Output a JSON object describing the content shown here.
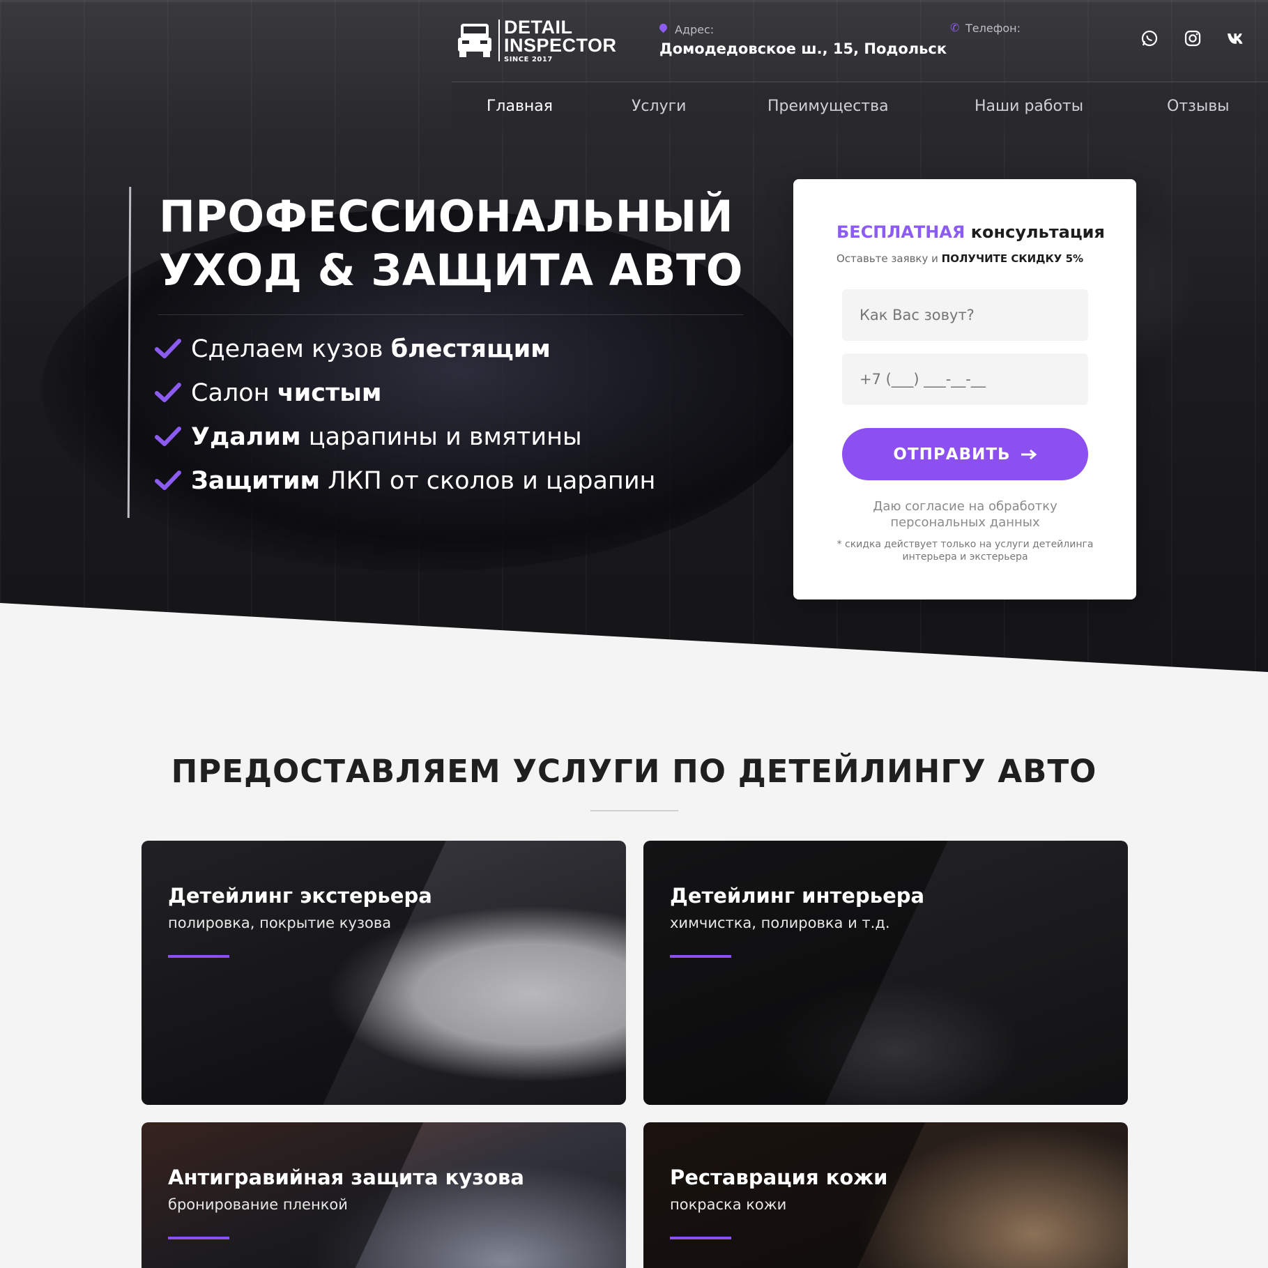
{
  "brand": {
    "line1": "DETAIL",
    "line2": "INSPECTOR",
    "since": "SINCE 2017"
  },
  "header": {
    "address_label": "Адрес:",
    "address_value": "Домодедовское ш., 15, Подольск",
    "phone_label": "Телефон:",
    "socials": [
      "whatsapp-icon",
      "instagram-icon",
      "vk-icon"
    ]
  },
  "nav": {
    "items": [
      "Главная",
      "Услуги",
      "Преимущества",
      "Наши работы",
      "Отзывы"
    ],
    "active": "Главная"
  },
  "hero": {
    "title_line1": "ПРОФЕССИОНАЛЬНЫЙ",
    "title_line2": "УХОД & ЗАЩИТА АВТО",
    "bullets": [
      {
        "plain_before": "Сделаем кузов ",
        "bold": "блестящим",
        "plain_after": ""
      },
      {
        "plain_before": "Салон ",
        "bold": "чистым",
        "plain_after": ""
      },
      {
        "plain_before": "",
        "bold": "Удалим",
        "plain_after": " царапины и вмятины"
      },
      {
        "plain_before": "",
        "bold": "Защитим",
        "plain_after": " ЛКП от сколов и царапин"
      }
    ]
  },
  "form": {
    "title_accent": "БЕСПЛАТНАЯ",
    "title_rest": " консультация",
    "sub_plain": "Оставьте заявку и ",
    "sub_bold": "ПОЛУЧИТЕ СКИДКУ 5%",
    "name_placeholder": "Как Вас зовут?",
    "phone_placeholder": "+7 (___) ___-__-__",
    "submit_label": "ОТПРАВИТЬ",
    "consent": "Даю согласие на обработку персональных данных",
    "disclaimer": "* скидка действует только на услуги детейлинга интерьера и экстерьера"
  },
  "services": {
    "title": "ПРЕДОСТАВЛЯЕМ УСЛУГИ ПО ДЕТЕЙЛИНГУ АВТО",
    "cards": [
      {
        "title": "Детейлинг экстерьера",
        "subtitle": "полировка, покрытие кузова"
      },
      {
        "title": "Детейлинг интерьера",
        "subtitle": "химчистка, полировка и т.д."
      },
      {
        "title": "Антигравийная защита кузова",
        "subtitle": "бронирование пленкой"
      },
      {
        "title": "Реставрация кожи",
        "subtitle": "покраска кожи"
      }
    ]
  },
  "colors": {
    "accent": "#8c4ff0",
    "dark_text": "#1f1f1f",
    "page_bg": "#f4f4f4"
  }
}
